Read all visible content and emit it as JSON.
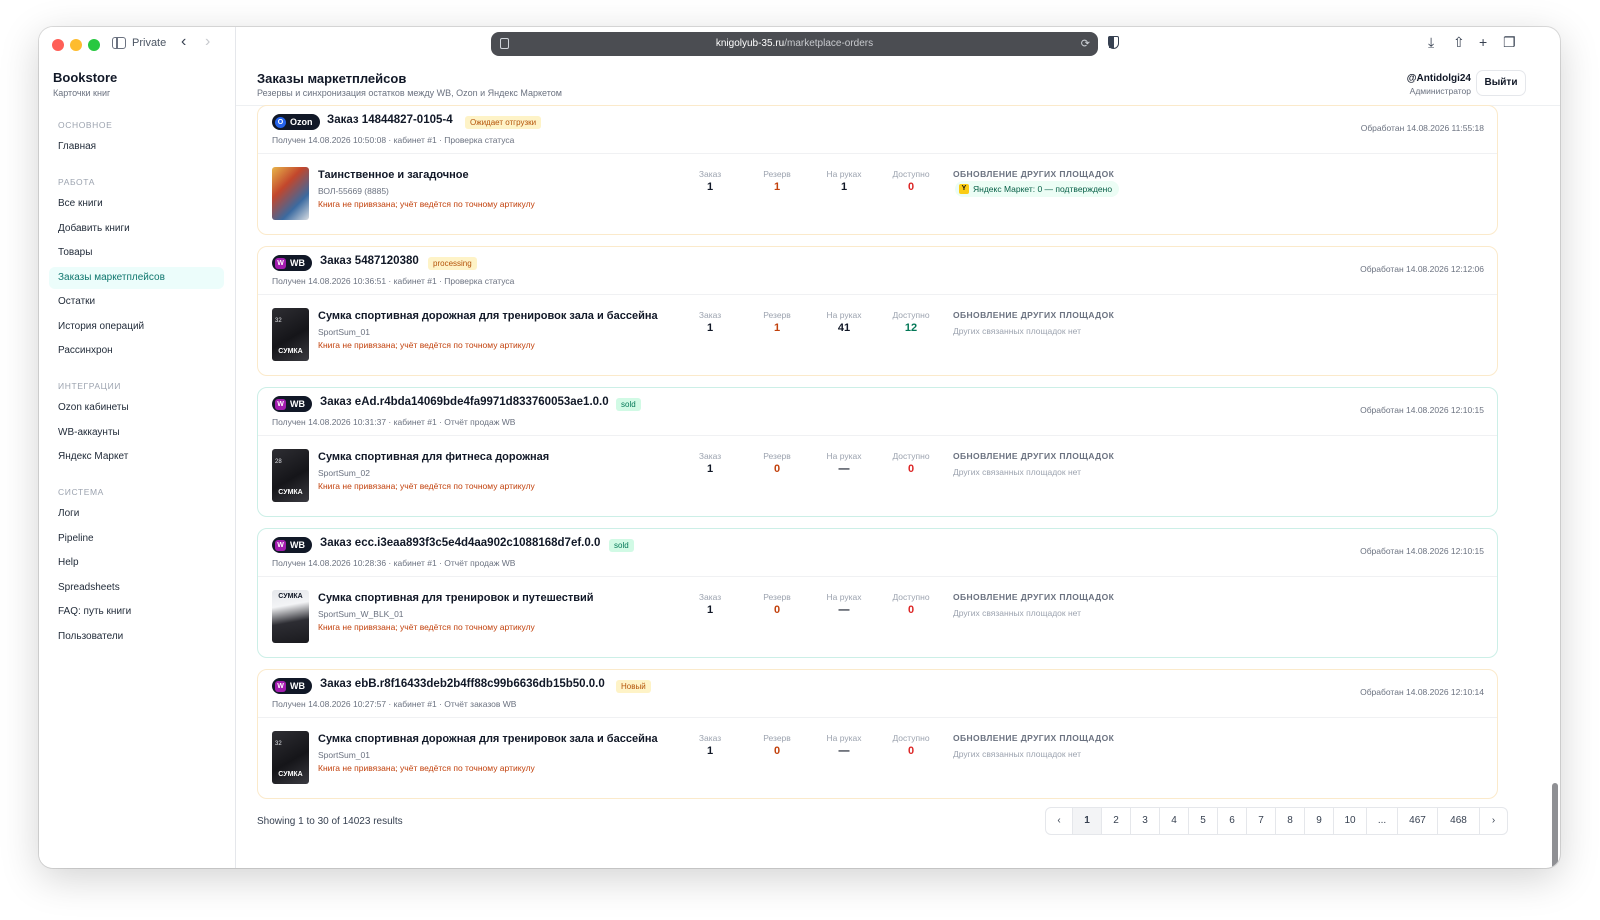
{
  "browser": {
    "private_label": "Private",
    "url_host": "knigolyub-35.ru",
    "url_path": "/marketplace-orders"
  },
  "sidebar": {
    "brand": "Bookstore",
    "brand_sub": "Карточки книг",
    "sections": {
      "main": "ОСНОВНОЕ",
      "work": "РАБОТА",
      "integrations": "ИНТЕГРАЦИИ",
      "system": "СИСТЕМА"
    },
    "items": {
      "home": "Главная",
      "all_books": "Все книги",
      "add_books": "Добавить книги",
      "products": "Товары",
      "mp_orders": "Заказы маркетплейсов",
      "stock": "Остатки",
      "history": "История операций",
      "resync": "Рассинхрон",
      "ozon": "Ozon кабинеты",
      "wb": "WB-аккаунты",
      "yandex": "Яндекс Маркет",
      "logs": "Логи",
      "pipeline": "Pipeline",
      "help": "Help",
      "spreadsheets": "Spreadsheets",
      "faq": "FAQ: путь книги",
      "users": "Пользователи"
    }
  },
  "header": {
    "title": "Заказы маркетплейсов",
    "subtitle": "Резервы и синхронизация остатков между WB, Ozon и Яндекс Маркетом",
    "user": "@Antidolgi24",
    "role": "Администратор",
    "logout": "Выйти"
  },
  "labels": {
    "order": "Заказ",
    "reserve": "Резерв",
    "on_hand": "На руках",
    "available": "Доступно",
    "updates_title": "ОБНОВЛЕНИЕ ДРУГИХ ПЛОЩАДОК",
    "no_links": "Других связанных площадок нет",
    "warning": "Книга не привязана; учёт ведётся по точному артикулу"
  },
  "orders": [
    {
      "marketplace": "Ozon",
      "title": "Заказ 14844827-0105-4",
      "status": "Ожидает отгрузки",
      "meta": "Получен 14.08.2026 10:50:08 · кабинет #1 · Проверка статуса",
      "processed": "Обработан 14.08.2026 11:55:18",
      "product": "Таинственное и загадочное",
      "sku": "ВОЛ-55669 (8885)",
      "qty_order": "1",
      "qty_reserve": "1",
      "qty_hand": "1",
      "qty_avail": "0",
      "update": "Яндекс Маркет: 0 — подтверждено"
    },
    {
      "marketplace": "WB",
      "title": "Заказ 5487120380",
      "status": "processing",
      "meta": "Получен 14.08.2026 10:36:51 · кабинет #1 · Проверка статуса",
      "processed": "Обработан 14.08.2026 12:12:06",
      "product": "Сумка спортивная дорожная для тренировок зала и бассейна",
      "sku": "SportSum_01",
      "thumb_text": "СУМКА",
      "thumb_num": "32",
      "qty_order": "1",
      "qty_reserve": "1",
      "qty_hand": "41",
      "qty_avail": "12"
    },
    {
      "marketplace": "WB",
      "title": "Заказ eAd.r4bda14069bde4fa9971d833760053ae1.0.0",
      "status": "sold",
      "meta": "Получен 14.08.2026 10:31:37 · кабинет #1 · Отчёт продаж WB",
      "processed": "Обработан 14.08.2026 12:10:15",
      "product": "Сумка спортивная для фитнеса дорожная",
      "sku": "SportSum_02",
      "thumb_text": "СУМКА",
      "thumb_num": "28",
      "qty_order": "1",
      "qty_reserve": "0",
      "qty_hand": "—",
      "qty_avail": "0"
    },
    {
      "marketplace": "WB",
      "title": "Заказ ecc.i3eaa893f3c5e4d4aa902c1088168d7ef.0.0",
      "status": "sold",
      "meta": "Получен 14.08.2026 10:28:36 · кабинет #1 · Отчёт продаж WB",
      "processed": "Обработан 14.08.2026 12:10:15",
      "product": "Сумка спортивная для тренировок и путешествий",
      "sku": "SportSum_W_BLK_01",
      "thumb_text": "СУМКА",
      "qty_order": "1",
      "qty_reserve": "0",
      "qty_hand": "—",
      "qty_avail": "0"
    },
    {
      "marketplace": "WB",
      "title": "Заказ ebB.r8f16433deb2b4ff88c99b6636db15b50.0.0",
      "status": "Новый",
      "meta": "Получен 14.08.2026 10:27:57 · кабинет #1 · Отчёт заказов WB",
      "processed": "Обработан 14.08.2026 12:10:14",
      "product": "Сумка спортивная дорожная для тренировок зала и бассейна",
      "sku": "SportSum_01",
      "thumb_text": "СУМКА",
      "thumb_num": "32",
      "qty_order": "1",
      "qty_reserve": "0",
      "qty_hand": "—",
      "qty_avail": "0"
    }
  ],
  "pagination": {
    "showing": "Showing 1 to 30 of 14023 results",
    "prev": "‹",
    "next": "›",
    "pages": [
      "1",
      "2",
      "3",
      "4",
      "5",
      "6",
      "7",
      "8",
      "9",
      "10",
      "...",
      "467",
      "468"
    ],
    "current": "1"
  }
}
